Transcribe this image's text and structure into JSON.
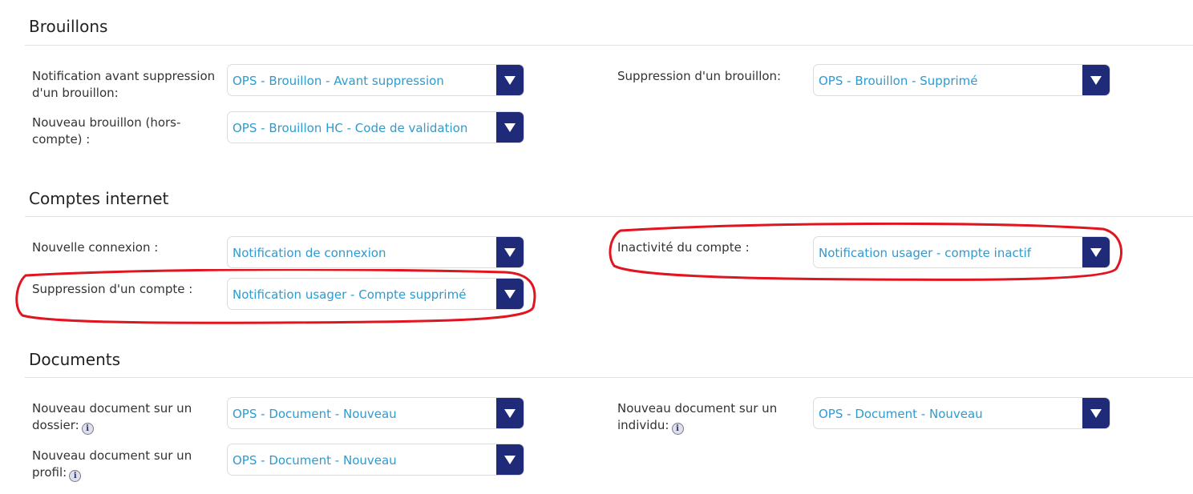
{
  "sections": {
    "brouillons": {
      "title": "Brouillons",
      "fields": [
        {
          "label": "Notification avant suppression d'un brouillon:",
          "value": "OPS - Brouillon - Avant suppression"
        },
        {
          "label": "Suppression d'un brouillon:",
          "value": "OPS - Brouillon - Supprimé"
        },
        {
          "label": "Nouveau brouillon (hors-compte) :",
          "value": "OPS - Brouillon HC - Code de validation"
        }
      ]
    },
    "comptes": {
      "title": "Comptes internet",
      "fields": [
        {
          "label": "Nouvelle connexion :",
          "value": "Notification de connexion"
        },
        {
          "label": "Inactivité du compte :",
          "value": "Notification usager - compte inactif"
        },
        {
          "label": "Suppression d'un compte :",
          "value": "Notification usager - Compte supprimé"
        }
      ]
    },
    "documents": {
      "title": "Documents",
      "fields": [
        {
          "label": "Nouveau document sur un dossier:",
          "value": "OPS - Document - Nouveau"
        },
        {
          "label": "Nouveau document sur un individu:",
          "value": "OPS - Document - Nouveau"
        },
        {
          "label": "Nouveau document sur un profil:",
          "value": "OPS - Document - Nouveau"
        }
      ]
    }
  },
  "icons": {
    "info": "i"
  },
  "colors": {
    "select_text": "#2e9bd0",
    "select_arrow_bg": "#1f2a78",
    "highlight": "#e0151f"
  }
}
